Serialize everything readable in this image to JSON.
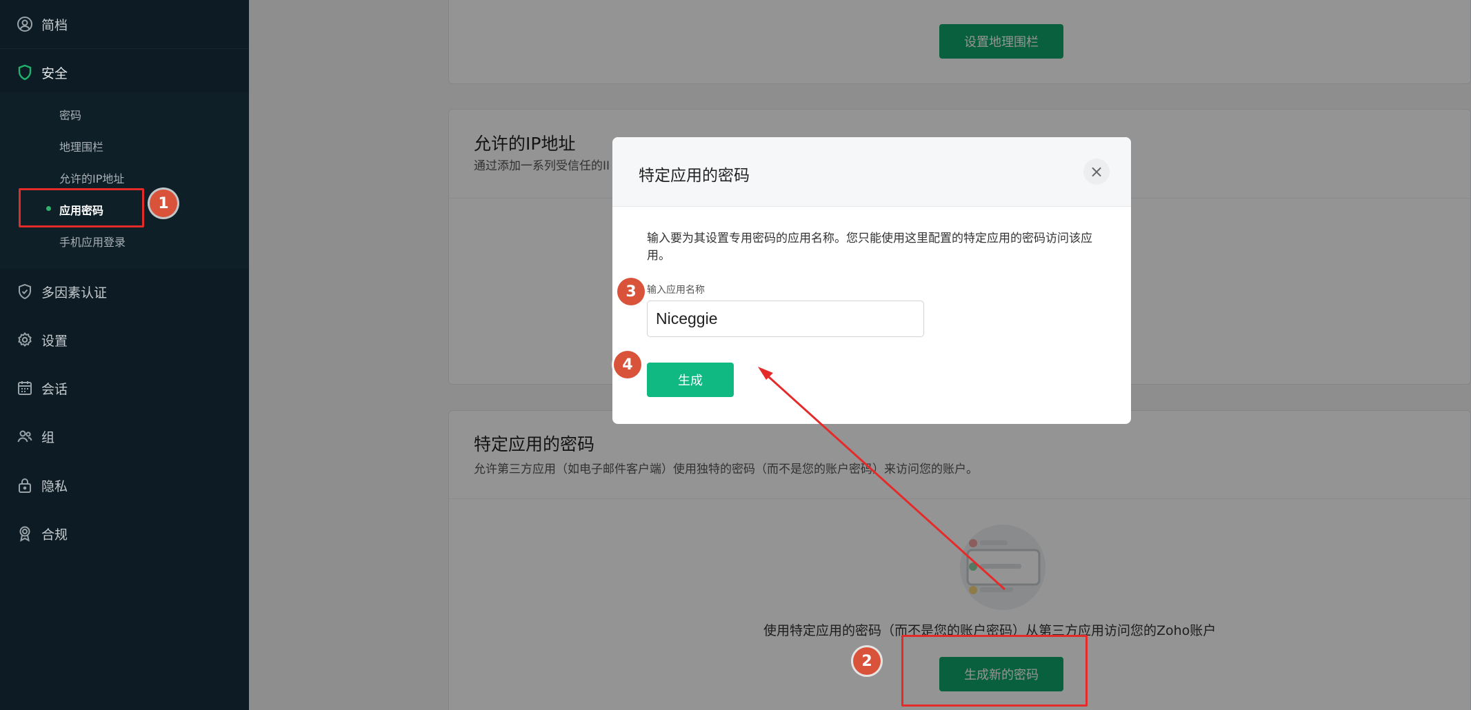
{
  "sidebar": {
    "items": [
      {
        "label": "简档",
        "icon": "profile-icon"
      },
      {
        "label": "安全",
        "icon": "shield-icon"
      },
      {
        "label": "多因素认证",
        "icon": "shield-check-icon"
      },
      {
        "label": "设置",
        "icon": "gear-icon"
      },
      {
        "label": "会话",
        "icon": "calendar-icon"
      },
      {
        "label": "组",
        "icon": "group-icon"
      },
      {
        "label": "隐私",
        "icon": "lock-icon"
      },
      {
        "label": "合规",
        "icon": "award-icon"
      }
    ],
    "security_sub": [
      {
        "label": "密码"
      },
      {
        "label": "地理围栏"
      },
      {
        "label": "允许的IP地址"
      },
      {
        "label": "应用密码"
      },
      {
        "label": "手机应用登录"
      }
    ]
  },
  "main": {
    "geofence_button": "设置地理围栏",
    "ip_card": {
      "title": "允许的IP地址",
      "desc": "通过添加一系列受信任的II"
    },
    "app_pw_card": {
      "title": "特定应用的密码",
      "desc": "允许第三方应用（如电子邮件客户端）使用独特的密码（而不是您的账户密码）来访问您的账户。",
      "empty_text": "使用特定应用的密码（而不是您的账户密码）从第三方应用访问您的Zoho账户",
      "button": "生成新的密码"
    }
  },
  "modal": {
    "title": "特定应用的密码",
    "close": "×",
    "desc": "输入要为其设置专用密码的应用名称。您只能使用这里配置的特定应用的密码访问该应用。",
    "field_label": "输入应用名称",
    "field_value": "Niceggie",
    "generate_button": "生成"
  },
  "annotations": {
    "badges": [
      "1",
      "2",
      "3",
      "4"
    ]
  },
  "colors": {
    "sidebar_bg": "#0d1c24",
    "accent_green": "#10a56b",
    "annotation_red": "#e52a2a",
    "badge": "#d9523a"
  }
}
